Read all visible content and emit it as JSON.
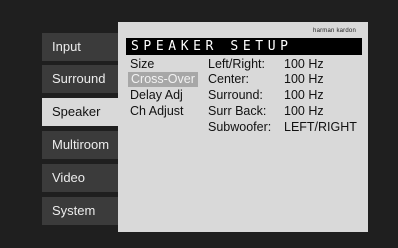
{
  "menu": {
    "tabs": [
      {
        "label": "Input"
      },
      {
        "label": "Surround"
      },
      {
        "label": "Speaker"
      },
      {
        "label": "Multiroom"
      },
      {
        "label": "Video"
      },
      {
        "label": "System"
      }
    ],
    "active": "Speaker"
  },
  "panel": {
    "brand": "harman kardon",
    "title": "SPEAKER SETUP",
    "submenu": [
      {
        "label": "Size"
      },
      {
        "label": "Cross-Over"
      },
      {
        "label": "Delay Adj"
      },
      {
        "label": "Ch Adjust"
      }
    ],
    "selected_submenu": "Cross-Over",
    "settings": [
      {
        "label": "Left/Right:",
        "value": "100 Hz"
      },
      {
        "label": "Center:",
        "value": "100 Hz"
      },
      {
        "label": "Surround:",
        "value": "100 Hz"
      },
      {
        "label": "Surr Back:",
        "value": "100 Hz"
      },
      {
        "label": "Subwoofer:",
        "value": "LEFT/RIGHT"
      }
    ]
  },
  "colors": {
    "screen_bg": "#1f1f1f",
    "tab_bg": "#3b3b3b",
    "panel_bg": "#d9d9d9",
    "selected_bg": "#a7a7a7",
    "title_bg": "#000000"
  }
}
